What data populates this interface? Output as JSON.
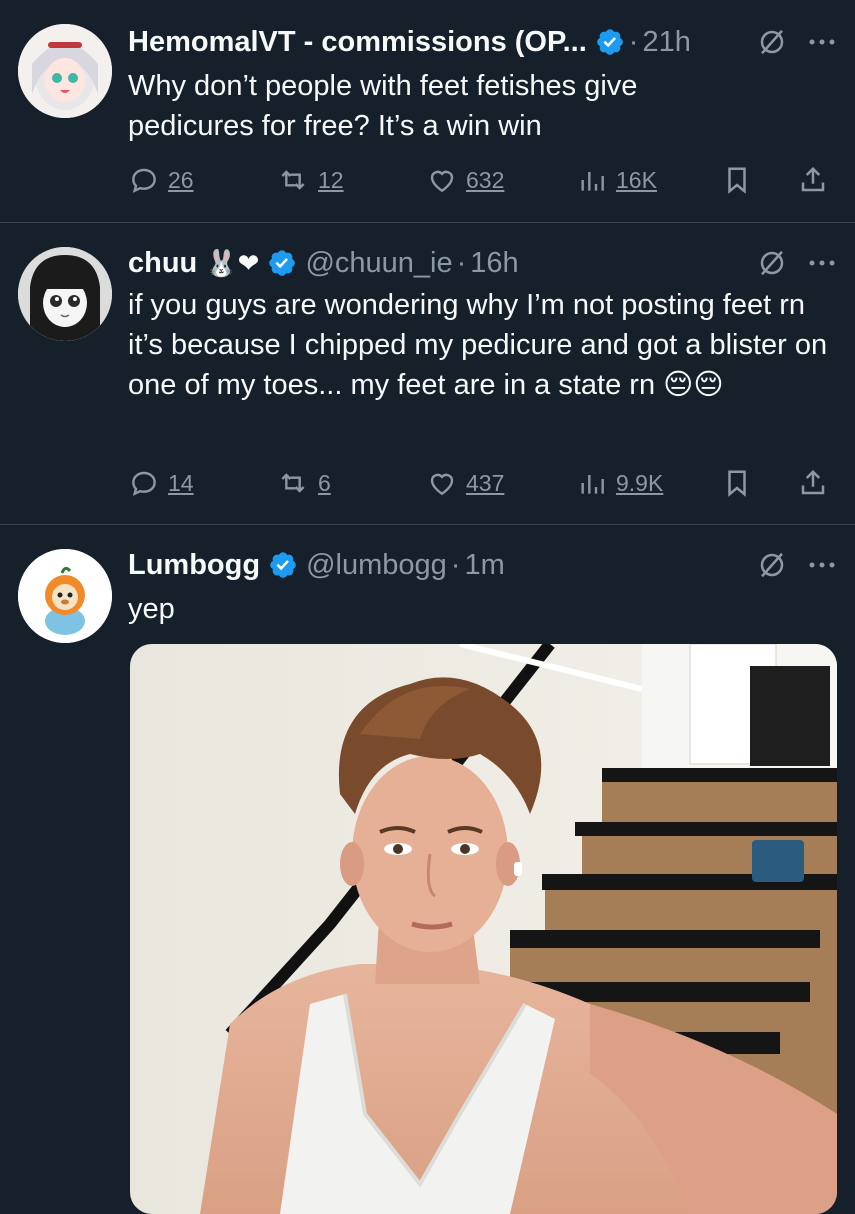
{
  "colors": {
    "background": "#15202b",
    "text": "#f7f9f9",
    "muted": "#8b98a5",
    "divider": "#38444d",
    "verified": "#1d9bf0"
  },
  "tweets": [
    {
      "name": "HemomalVT - commissions (OP...",
      "handle": "",
      "time": "21h",
      "text": "Why don’t people with feet fetishes give pedicures for free? It’s a win win",
      "replies": "26",
      "reposts": "12",
      "likes": "632",
      "views": "16K"
    },
    {
      "name": "chuu",
      "name_emoji": "🐰❤",
      "handle": "@chuun_ie",
      "time": "16h",
      "text": "if you guys are wondering why I’m not posting feet rn it’s because I chipped my pedicure and got a blister on one of my toes... my feet are in a state rn",
      "text_emoji": "😔😔",
      "replies": "14",
      "reposts": "6",
      "likes": "437",
      "views": "9.9K"
    },
    {
      "name": "Lumbogg",
      "handle": "@lumbogg",
      "time": "1m",
      "text": "yep"
    }
  ],
  "separator": "·",
  "icons": {
    "reply": "reply-icon",
    "repost": "repost-icon",
    "like": "heart-icon",
    "views": "views-icon",
    "bookmark": "bookmark-icon",
    "share": "share-icon",
    "grok": "grok-icon",
    "more": "more-icon",
    "verified": "verified-badge-icon"
  }
}
